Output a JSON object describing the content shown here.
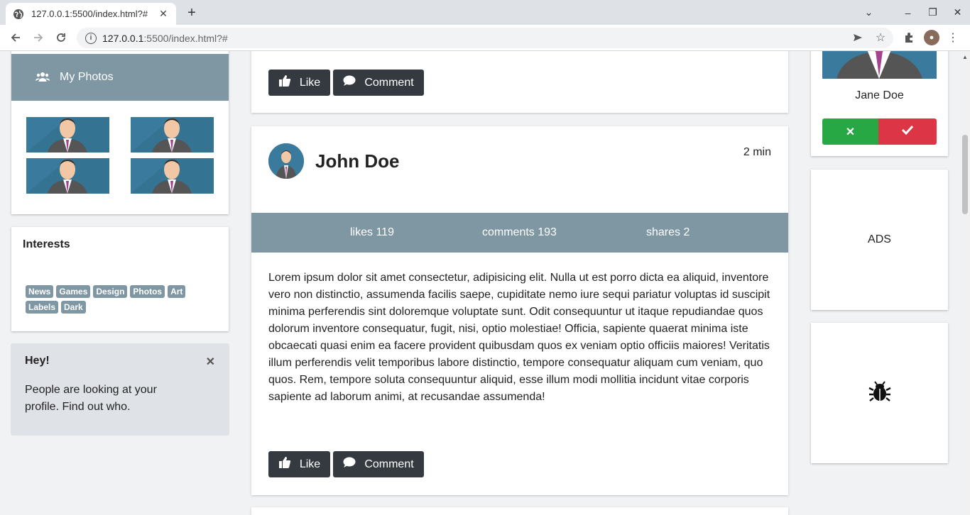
{
  "browser": {
    "tab_title": "127.0.0.1:5500/index.html?#",
    "url_host": "127.0.0.1",
    "url_path": ":5500/index.html?#"
  },
  "sidebar": {
    "photos_title": "My Photos",
    "interests_title": "Interests",
    "tags": [
      "News",
      "Games",
      "Design",
      "Photos",
      "Art",
      "Labels",
      "Dark"
    ],
    "alert": {
      "title": "Hey!",
      "text": "People are looking at your profile. Find out who."
    }
  },
  "posts": [
    {
      "like_label": "Like",
      "comment_label": "Comment"
    },
    {
      "author": "John Doe",
      "time": "2 min",
      "likes": "likes 119",
      "comments": "comments 193",
      "shares": "shares 2",
      "body": "Lorem ipsum dolor sit amet consectetur, adipisicing elit. Nulla ut est porro dicta ea aliquid, inventore vero non distinctio, assumenda facilis saepe, cupiditate nemo iure sequi pariatur voluptas id suscipit minima perferendis sint doloremque voluptate sunt. Odit consequuntur ut itaque repudiandae quos dolorum inventore consequatur, fugit, nisi, optio molestiae! Officia, sapiente quaerat minima iste obcaecati quasi enim ea facere provident quibusdam quos ex veniam optio officiis maiores! Veritatis illum perferendis velit temporibus labore distinctio, tempore consequatur aliquam cum veniam, quo quos. Rem, tempore soluta consequuntur aliquid, esse illum modi mollitia incidunt vitae corporis sapiente ad laborum animi, at recusandae assumenda!",
      "like_label": "Like",
      "comment_label": "Comment"
    }
  ],
  "right": {
    "friend_name": "Jane Doe",
    "ads_label": "ADS"
  },
  "colors": {
    "accent": "#7f96a3",
    "dark_button": "#343a40",
    "decline_green": "#28a745",
    "accept_red": "#dc3545"
  }
}
